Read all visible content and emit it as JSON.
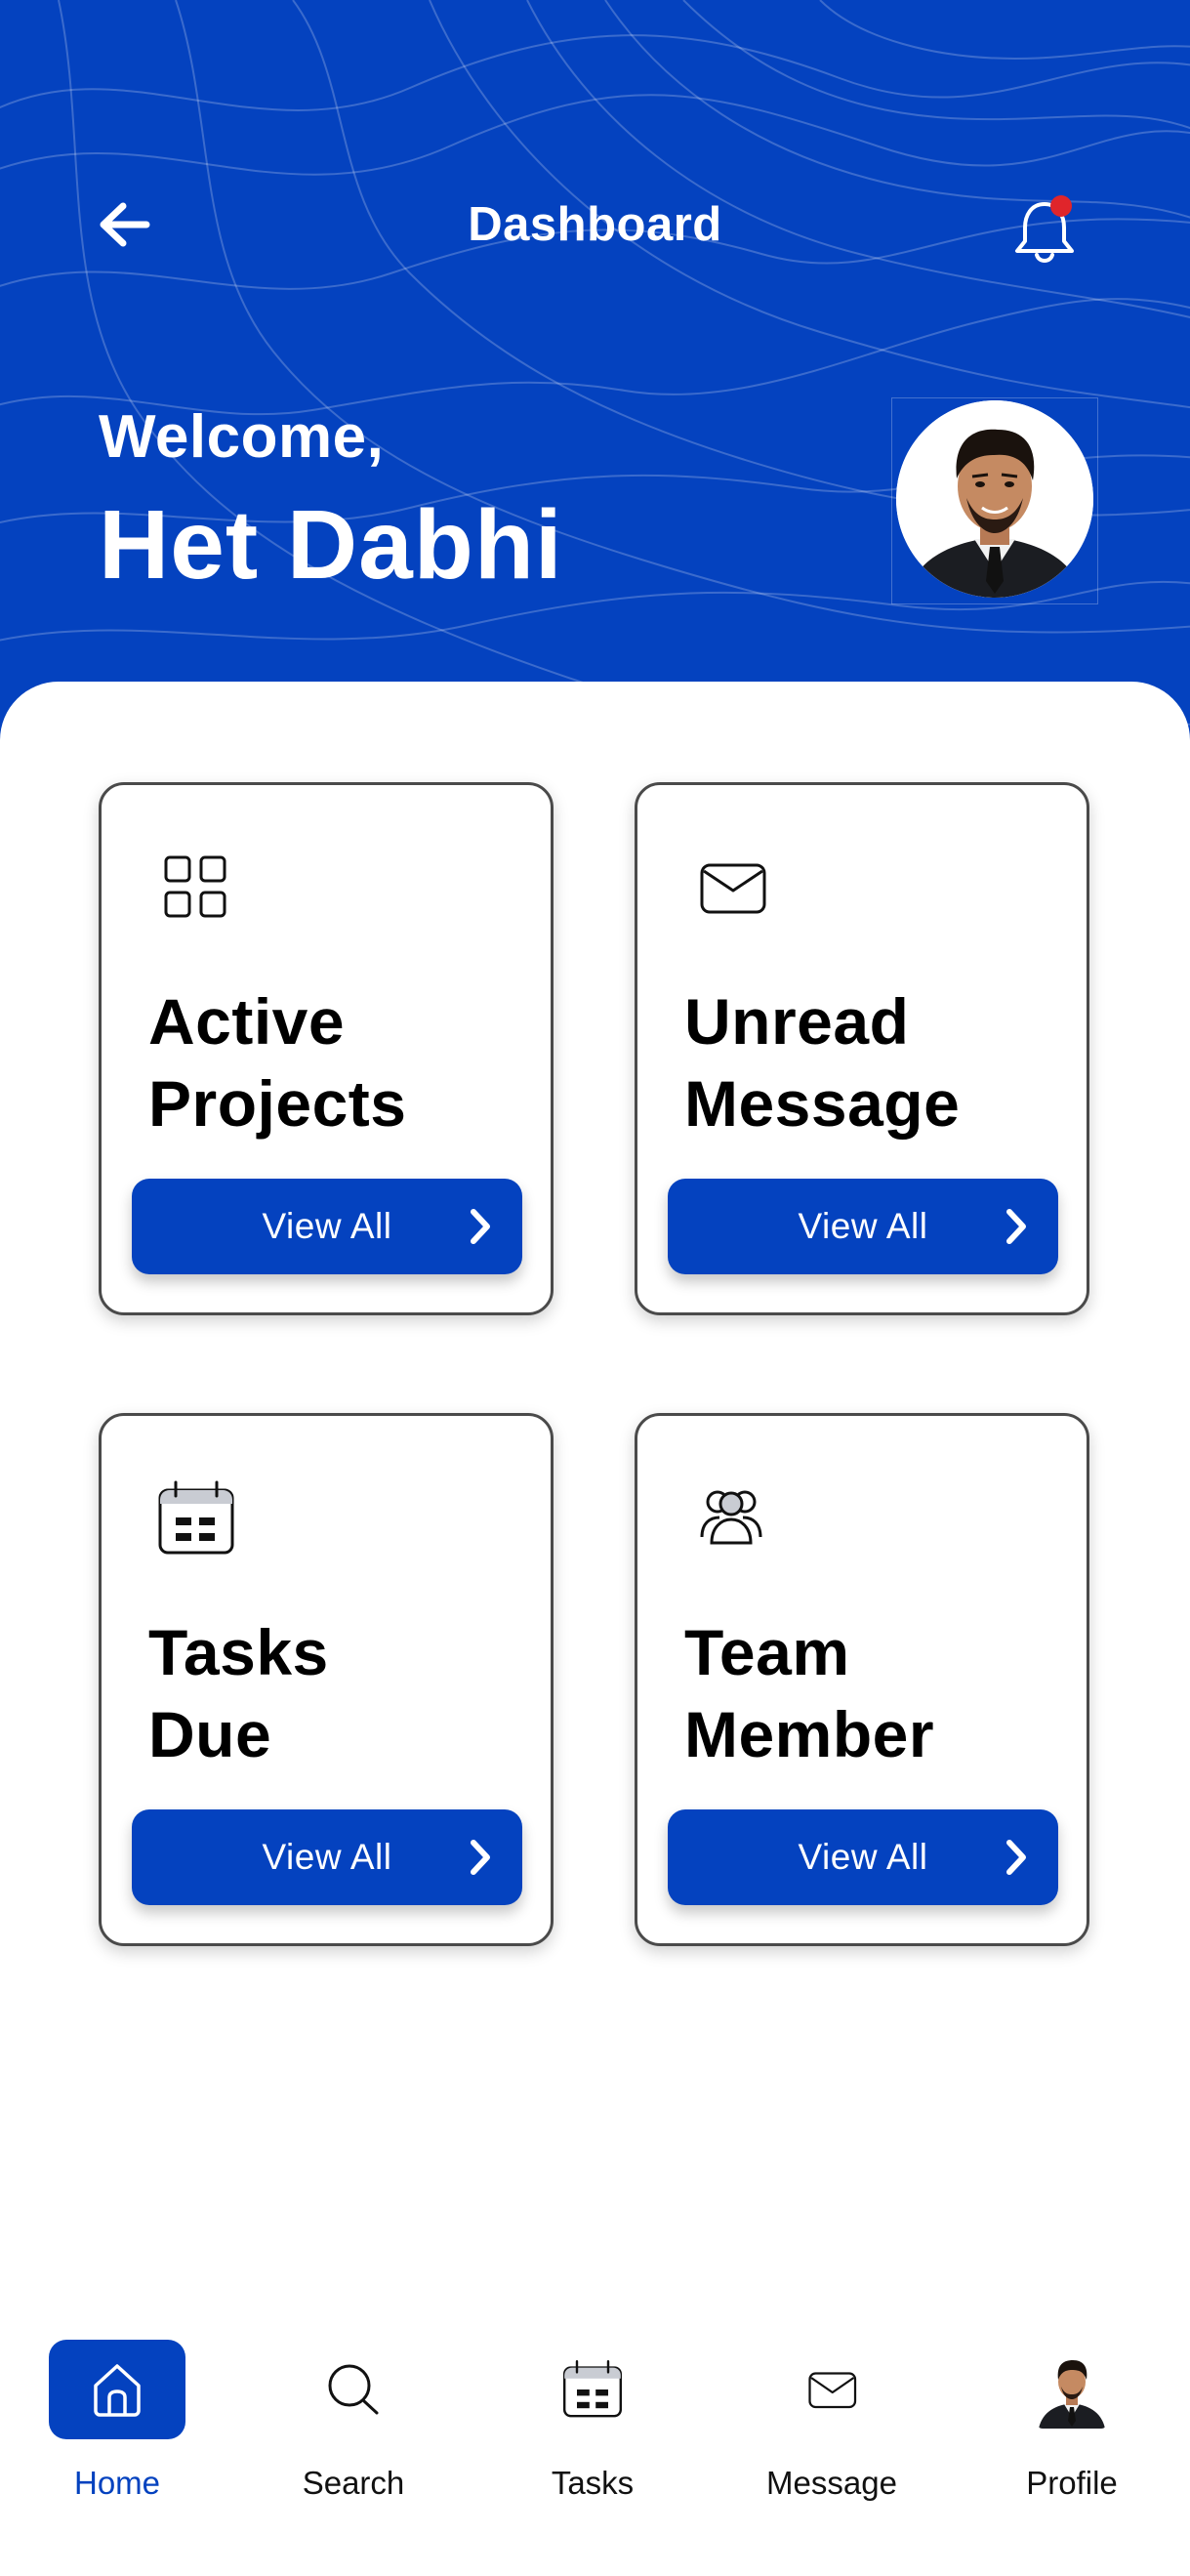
{
  "header": {
    "title": "Dashboard",
    "back_icon": "arrow-left-icon",
    "notification_icon": "bell-icon",
    "notification_dot_color": "#e0252b"
  },
  "greeting": {
    "welcome": "Welcome,",
    "name": "Het Dabhi"
  },
  "theme": {
    "primary": "#0442bf",
    "background": "#ffffff",
    "text": "#000000"
  },
  "cards": [
    {
      "icon": "grid-icon",
      "title_line1": "Active",
      "title_line2": "Projects",
      "button": "View All"
    },
    {
      "icon": "envelope-icon",
      "title_line1": "Unread",
      "title_line2": "Message",
      "button": "View All"
    },
    {
      "icon": "calendar-icon",
      "title_line1": "Tasks",
      "title_line2": "Due",
      "button": "View All"
    },
    {
      "icon": "team-icon",
      "title_line1": "Team",
      "title_line2": "Member",
      "button": "View All"
    }
  ],
  "nav": [
    {
      "label": "Home",
      "icon": "home-icon",
      "active": true
    },
    {
      "label": "Search",
      "icon": "search-icon",
      "active": false
    },
    {
      "label": "Tasks",
      "icon": "calendar-icon",
      "active": false
    },
    {
      "label": "Message",
      "icon": "envelope-icon",
      "active": false
    },
    {
      "label": "Profile",
      "icon": "avatar",
      "active": false
    }
  ]
}
